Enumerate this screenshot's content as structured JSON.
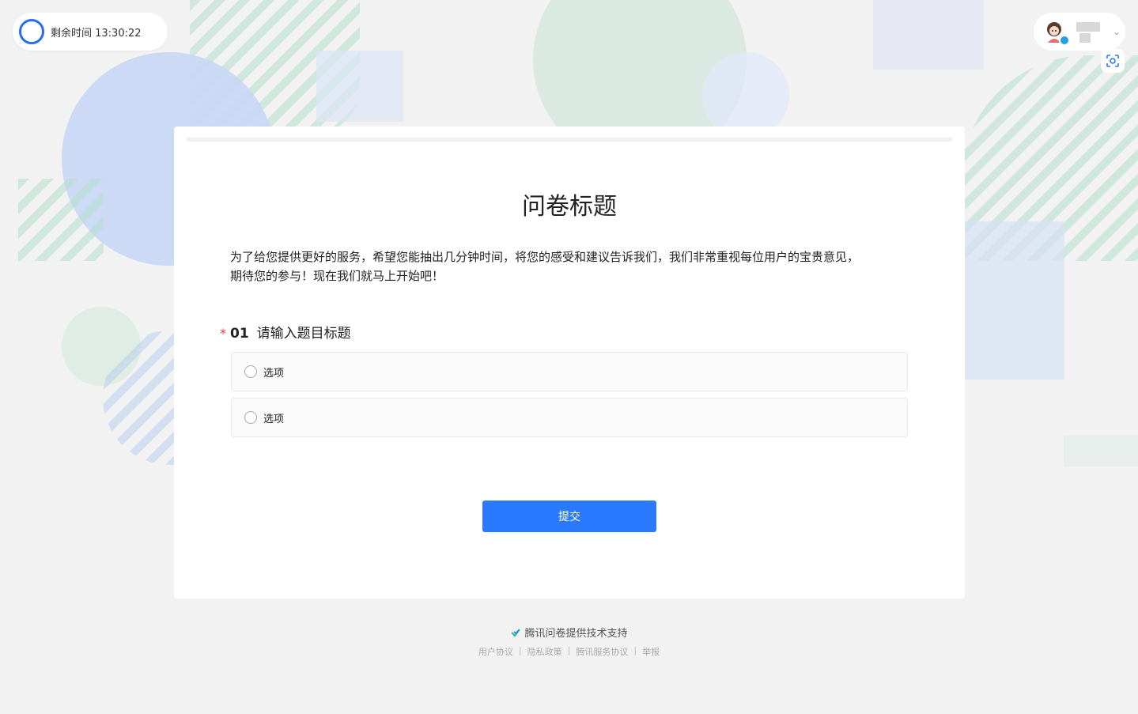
{
  "timer": {
    "label": "剩余时间 13:30:22"
  },
  "survey": {
    "title": "问卷标题",
    "description_line1": "为了给您提供更好的服务，希望您能抽出几分钟时间，将您的感受和建议告诉我们，我们非常重视每位用户的宝贵意见，",
    "description_line2": "期待您的参与！现在我们就马上开始吧！"
  },
  "question": {
    "required_mark": "*",
    "number": "01",
    "title": "请输入题目标题",
    "options": [
      {
        "label": "选项"
      },
      {
        "label": "选项"
      }
    ]
  },
  "submit_label": "提交",
  "footer": {
    "powered_by": "腾讯问卷提供技术支持",
    "links": [
      "用户协议",
      "隐私政策",
      "腾讯服务协议",
      "举报"
    ],
    "separator": "|"
  },
  "colors": {
    "accent": "#2b79ff",
    "required": "#e0393e",
    "timer_ring": "#2a6bf0"
  },
  "icons": {
    "timer": "circle-ring-icon",
    "avatar": "user-avatar",
    "scan": "scan-icon",
    "chevron": "chevron-down-icon",
    "logo": "check-logo-icon"
  }
}
